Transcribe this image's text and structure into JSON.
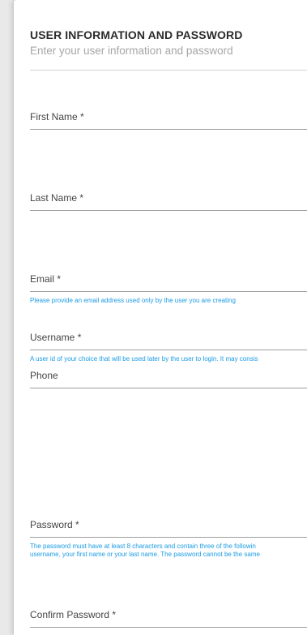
{
  "section": {
    "title": "USER INFORMATION AND PASSWORD",
    "subtitle": "Enter your user information and password"
  },
  "fields": {
    "first_name": {
      "label": "First Name *"
    },
    "last_name": {
      "label": "Last Name *"
    },
    "email": {
      "label": "Email *",
      "help": "Please provide an email address used only by the user you are creating"
    },
    "username": {
      "label": "Username *",
      "help": "A user id of your choice that will be used later by the user to login. It may consis"
    },
    "phone": {
      "label": "Phone"
    },
    "password": {
      "label": "Password *",
      "help_line1": "The password must have at least 8 characters and contain three of the followin",
      "help_line2": "username, your first name or your last name. The password cannot be the same"
    },
    "confirm_password": {
      "label": "Confirm Password *"
    }
  }
}
